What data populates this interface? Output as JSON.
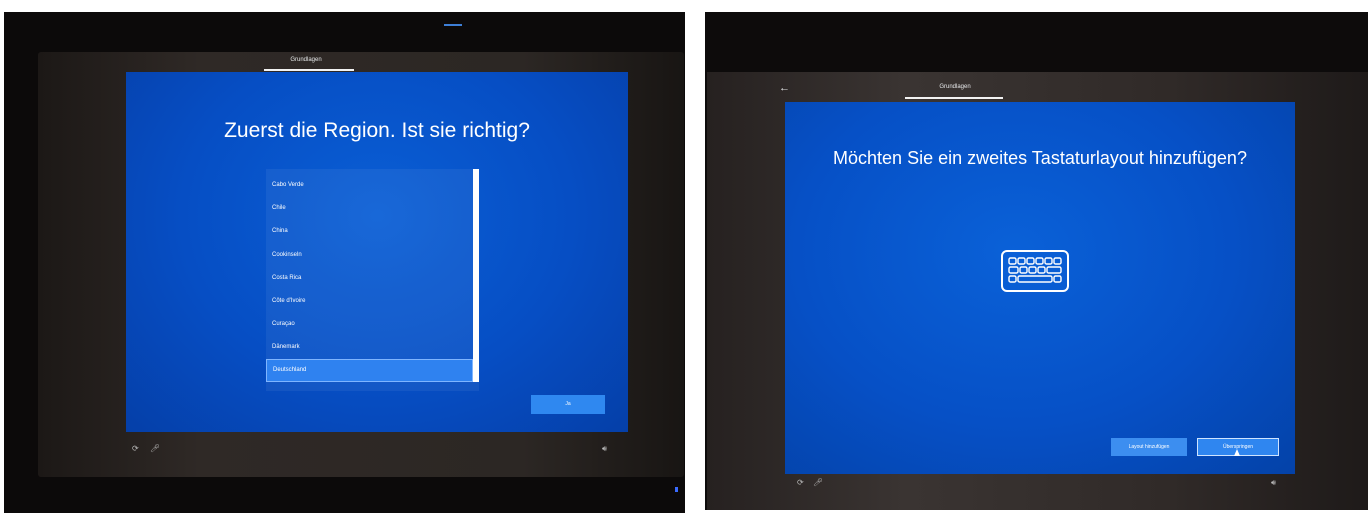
{
  "left_screen": {
    "tab_label": "Grundlagen",
    "title": "Zuerst die Region. Ist sie richtig?",
    "regions": [
      {
        "label": "Cabo Verde",
        "selected": false
      },
      {
        "label": "Chile",
        "selected": false
      },
      {
        "label": "China",
        "selected": false
      },
      {
        "label": "Cookinseln",
        "selected": false
      },
      {
        "label": "Costa Rica",
        "selected": false
      },
      {
        "label": "Côte d'Ivoire",
        "selected": false
      },
      {
        "label": "Curaçao",
        "selected": false
      },
      {
        "label": "Dänemark",
        "selected": false
      },
      {
        "label": "Deutschland",
        "selected": true
      }
    ],
    "confirm_button": "Ja",
    "taskbar": {
      "icons": [
        "accessibility-icon",
        "microphone-icon",
        "volume-icon"
      ]
    }
  },
  "right_screen": {
    "tab_label": "Grundlagen",
    "back_icon": "back-arrow-icon",
    "title": "Möchten Sie ein zweites Tastaturlayout hinzufügen?",
    "illustration_icon": "keyboard-icon",
    "add_layout_button": "Layout hinzufügen",
    "skip_button": "Überspringen",
    "taskbar": {
      "icons": [
        "accessibility-icon",
        "microphone-icon",
        "volume-icon"
      ]
    }
  },
  "colors": {
    "screen_blue": "#064ec4",
    "button_blue": "#2f88f0",
    "selected_item": "#2f82f0",
    "bezel": "#2f2926"
  }
}
